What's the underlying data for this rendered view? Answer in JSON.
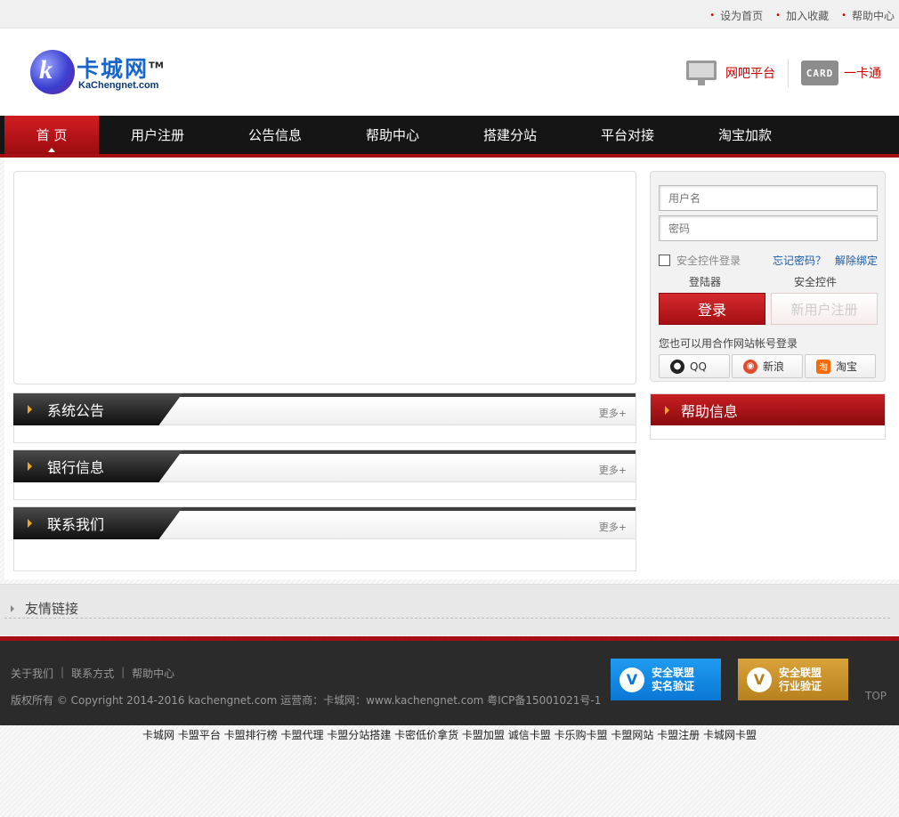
{
  "topbar": {
    "links": [
      "设为首页",
      "加入收藏",
      "帮助中心"
    ]
  },
  "logo": {
    "title": "卡城网",
    "tm": "TM",
    "sub": "KaChengnet.com",
    "letter": "k"
  },
  "header_right": {
    "item1": "网吧平台",
    "item2": "一卡通",
    "card_text": "CARD"
  },
  "nav": {
    "items": [
      "首 页",
      "用户注册",
      "公告信息",
      "帮助中心",
      "搭建分站",
      "平台对接",
      "淘宝加款"
    ]
  },
  "panels": {
    "notice": {
      "title": "系统公告",
      "more": "更多+"
    },
    "bank": {
      "title": "银行信息",
      "more": "更多+"
    },
    "contact": {
      "title": "联系我们",
      "more": "更多+"
    }
  },
  "login": {
    "username_placeholder": "用户名",
    "password_placeholder": "密码",
    "safe_label": "安全控件登录",
    "forgot": "忘记密码？",
    "unbind": "解除绑定",
    "label_client": "登陆器",
    "label_control": "安全控件",
    "login_btn": "登录",
    "register_btn": "新用户注册",
    "partner_tip": "您也可以用合作网站帐号登录",
    "partners": [
      "QQ",
      "新浪",
      "淘宝"
    ]
  },
  "help": {
    "title": "帮助信息"
  },
  "friend": {
    "title": "友情链接"
  },
  "footer": {
    "links": [
      "关于我们",
      "联系方式",
      "帮助中心"
    ],
    "separator": "|",
    "copyright": "版权所有 ©   Copyright 2014-2016 kachengnet.com   运营商：卡城网：www.kachengnet.com   粤ICP备15001021号-1",
    "cert1": [
      "安全联盟",
      "实名验证"
    ],
    "cert2": [
      "安全联盟",
      "行业验证"
    ],
    "top": "TOP"
  },
  "keywords": "卡城网 卡盟平台 卡盟排行榜 卡盟代理 卡盟分站搭建 卡密低价拿货 卡盟加盟 诚信卡盟 卡乐购卡盟 卡盟网站 卡盟注册 卡城网卡盟",
  "colors": {
    "brand_red": "#a80f14",
    "nav_bg": "#151515",
    "link_blue": "#1a5aa8"
  }
}
